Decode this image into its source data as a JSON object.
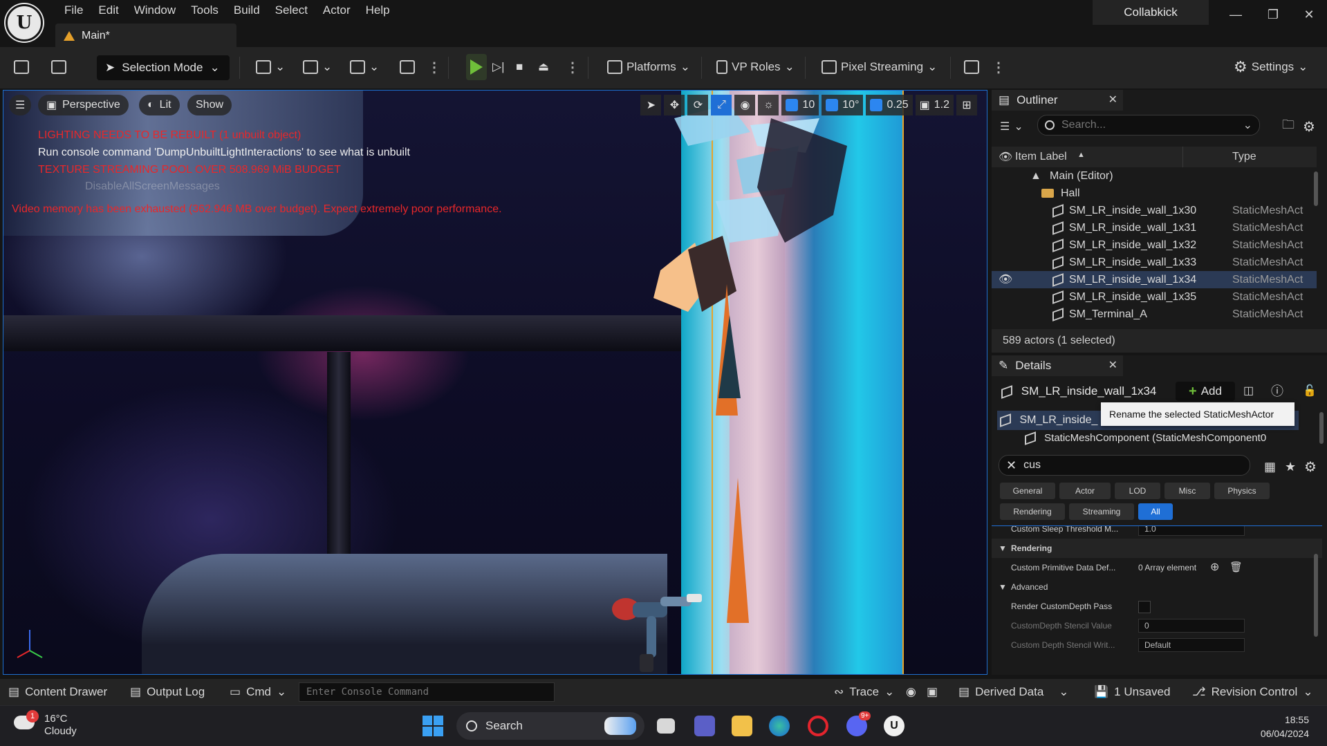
{
  "menu": [
    "File",
    "Edit",
    "Window",
    "Tools",
    "Build",
    "Select",
    "Actor",
    "Help"
  ],
  "doc_tab": "Main*",
  "project_name": "Collabkick",
  "toolbar": {
    "selection_mode": "Selection Mode",
    "platforms": "Platforms",
    "vp_roles": "VP Roles",
    "pixel_streaming": "Pixel Streaming",
    "settings": "Settings"
  },
  "viewport": {
    "perspective": "Perspective",
    "lit": "Lit",
    "show": "Show",
    "grid_snap": "10",
    "angle_snap": "10°",
    "scale_snap": "0.25",
    "camera_speed": "1.2",
    "messages": {
      "lighting": "LIGHTING NEEDS TO BE REBUILT (1 unbuilt object)",
      "console_hint": "Run console command 'DumpUnbuiltLightInteractions' to see what is unbuilt",
      "texture_pool": "TEXTURE STREAMING POOL OVER 508.969 MiB BUDGET",
      "disable_msgs": "DisableAllScreenMessages",
      "video_memory": "Video memory has been exhausted (362.946 MB over budget). Expect extremely poor performance."
    }
  },
  "outliner": {
    "title": "Outliner",
    "search_placeholder": "Search...",
    "col_label": "Item Label",
    "col_type": "Type",
    "root": "Main (Editor)",
    "folder": "Hall",
    "rows": [
      {
        "label": "SM_LR_inside_wall_1x30",
        "type": "StaticMeshAct"
      },
      {
        "label": "SM_LR_inside_wall_1x31",
        "type": "StaticMeshAct"
      },
      {
        "label": "SM_LR_inside_wall_1x32",
        "type": "StaticMeshAct"
      },
      {
        "label": "SM_LR_inside_wall_1x33",
        "type": "StaticMeshAct"
      },
      {
        "label": "SM_LR_inside_wall_1x34",
        "type": "StaticMeshAct"
      },
      {
        "label": "SM_LR_inside_wall_1x35",
        "type": "StaticMeshAct"
      },
      {
        "label": "SM_Terminal_A",
        "type": "StaticMeshAct"
      }
    ],
    "status": "589 actors (1 selected)"
  },
  "details": {
    "title": "Details",
    "actor_name": "SM_LR_inside_wall_1x34",
    "add_label": "Add",
    "tooltip": "Rename the selected StaticMeshActor",
    "component_root": "SM_LR_inside_",
    "component_child": "StaticMeshComponent (StaticMeshComponent0",
    "filter_text": "cus",
    "filters_row1": [
      "General",
      "Actor",
      "LOD",
      "Misc",
      "Physics"
    ],
    "filters_row2": [
      "Rendering",
      "Streaming",
      "All"
    ],
    "props": {
      "sleep_name": "Custom Sleep Threshold M...",
      "sleep_val": "1.0",
      "cat_rendering": "Rendering",
      "prim_name": "Custom Primitive Data Def...",
      "prim_val": "0 Array element",
      "cat_advanced": "Advanced",
      "depth_pass_name": "Render CustomDepth Pass",
      "stencil_val_name": "CustomDepth Stencil Value",
      "stencil_val": "0",
      "stencil_write_name": "Custom Depth Stencil Writ...",
      "stencil_write_val": "Default"
    }
  },
  "bottombar": {
    "content_drawer": "Content Drawer",
    "output_log": "Output Log",
    "cmd": "Cmd",
    "console_placeholder": "Enter Console Command",
    "trace": "Trace",
    "derived_data": "Derived Data",
    "unsaved": "1 Unsaved",
    "revision_control": "Revision Control"
  },
  "taskbar": {
    "temp": "16°C",
    "weather": "Cloudy",
    "weather_badge": "1",
    "search": "Search",
    "discord_badge": "9+",
    "time": "18:55",
    "date": "06/04/2024"
  }
}
